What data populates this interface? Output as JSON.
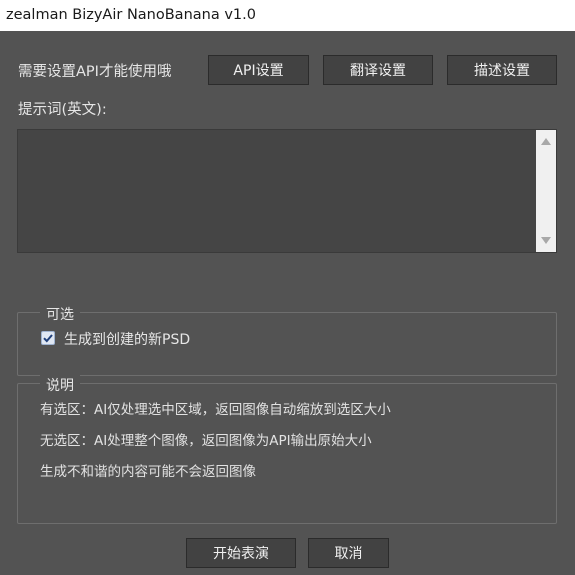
{
  "window": {
    "title": "zealman BizyAir NanoBanana v1.0"
  },
  "notice": "需要设置API才能使用哦",
  "toolbar": {
    "api_settings": "API设置",
    "translate_settings": "翻译设置",
    "describe_settings": "描述设置"
  },
  "prompt": {
    "label": "提示词(英文):",
    "value": ""
  },
  "options": {
    "legend": "可选",
    "create_new_psd": {
      "label": "生成到创建的新PSD",
      "checked": true
    }
  },
  "info": {
    "legend": "说明",
    "lines": [
      "有选区：AI仅处理选中区域，返回图像自动缩放到选区大小",
      "无选区：AI处理整个图像，返回图像为API输出原始大小",
      "生成不和谐的内容可能不会返回图像"
    ]
  },
  "actions": {
    "start": "开始表演",
    "cancel": "取消"
  },
  "colors": {
    "background": "#535353",
    "button": "#424242",
    "checkbox_check": "#1f3f7a"
  }
}
